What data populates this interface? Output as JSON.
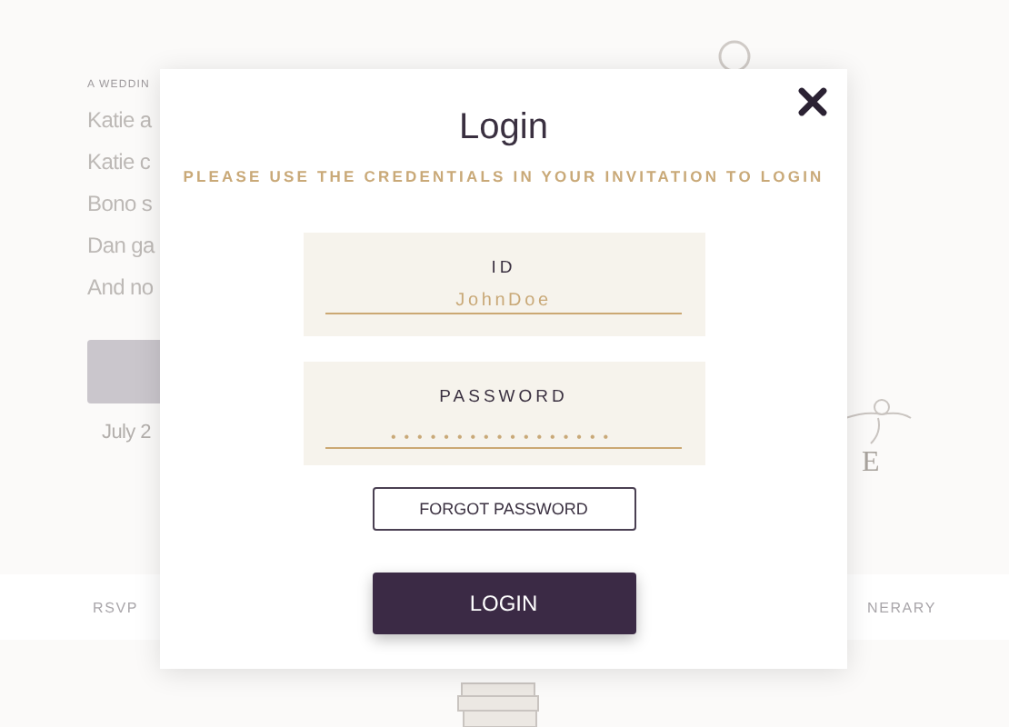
{
  "background_page": {
    "eyebrow": "A WEDDIN",
    "story_lines": [
      "Katie a",
      "Katie c",
      "Bono s",
      "Dan ga",
      "And no"
    ],
    "date": "July 2",
    "monogram_letter": "E",
    "nav_items": [
      "RSVP",
      "NERARY"
    ]
  },
  "login_dialog": {
    "title": "Login",
    "subtitle": "PLEASE USE THE CREDENTIALS IN YOUR INVITATION TO LOGIN",
    "fields": [
      {
        "kind": "text",
        "label": "ID",
        "value": "JohnDoe"
      },
      {
        "kind": "password",
        "label": "PASSWORD",
        "value": "•••••••••••••••••"
      }
    ],
    "forgot_button": "FORGOT PASSWORD",
    "login_button": "LOGIN"
  }
}
